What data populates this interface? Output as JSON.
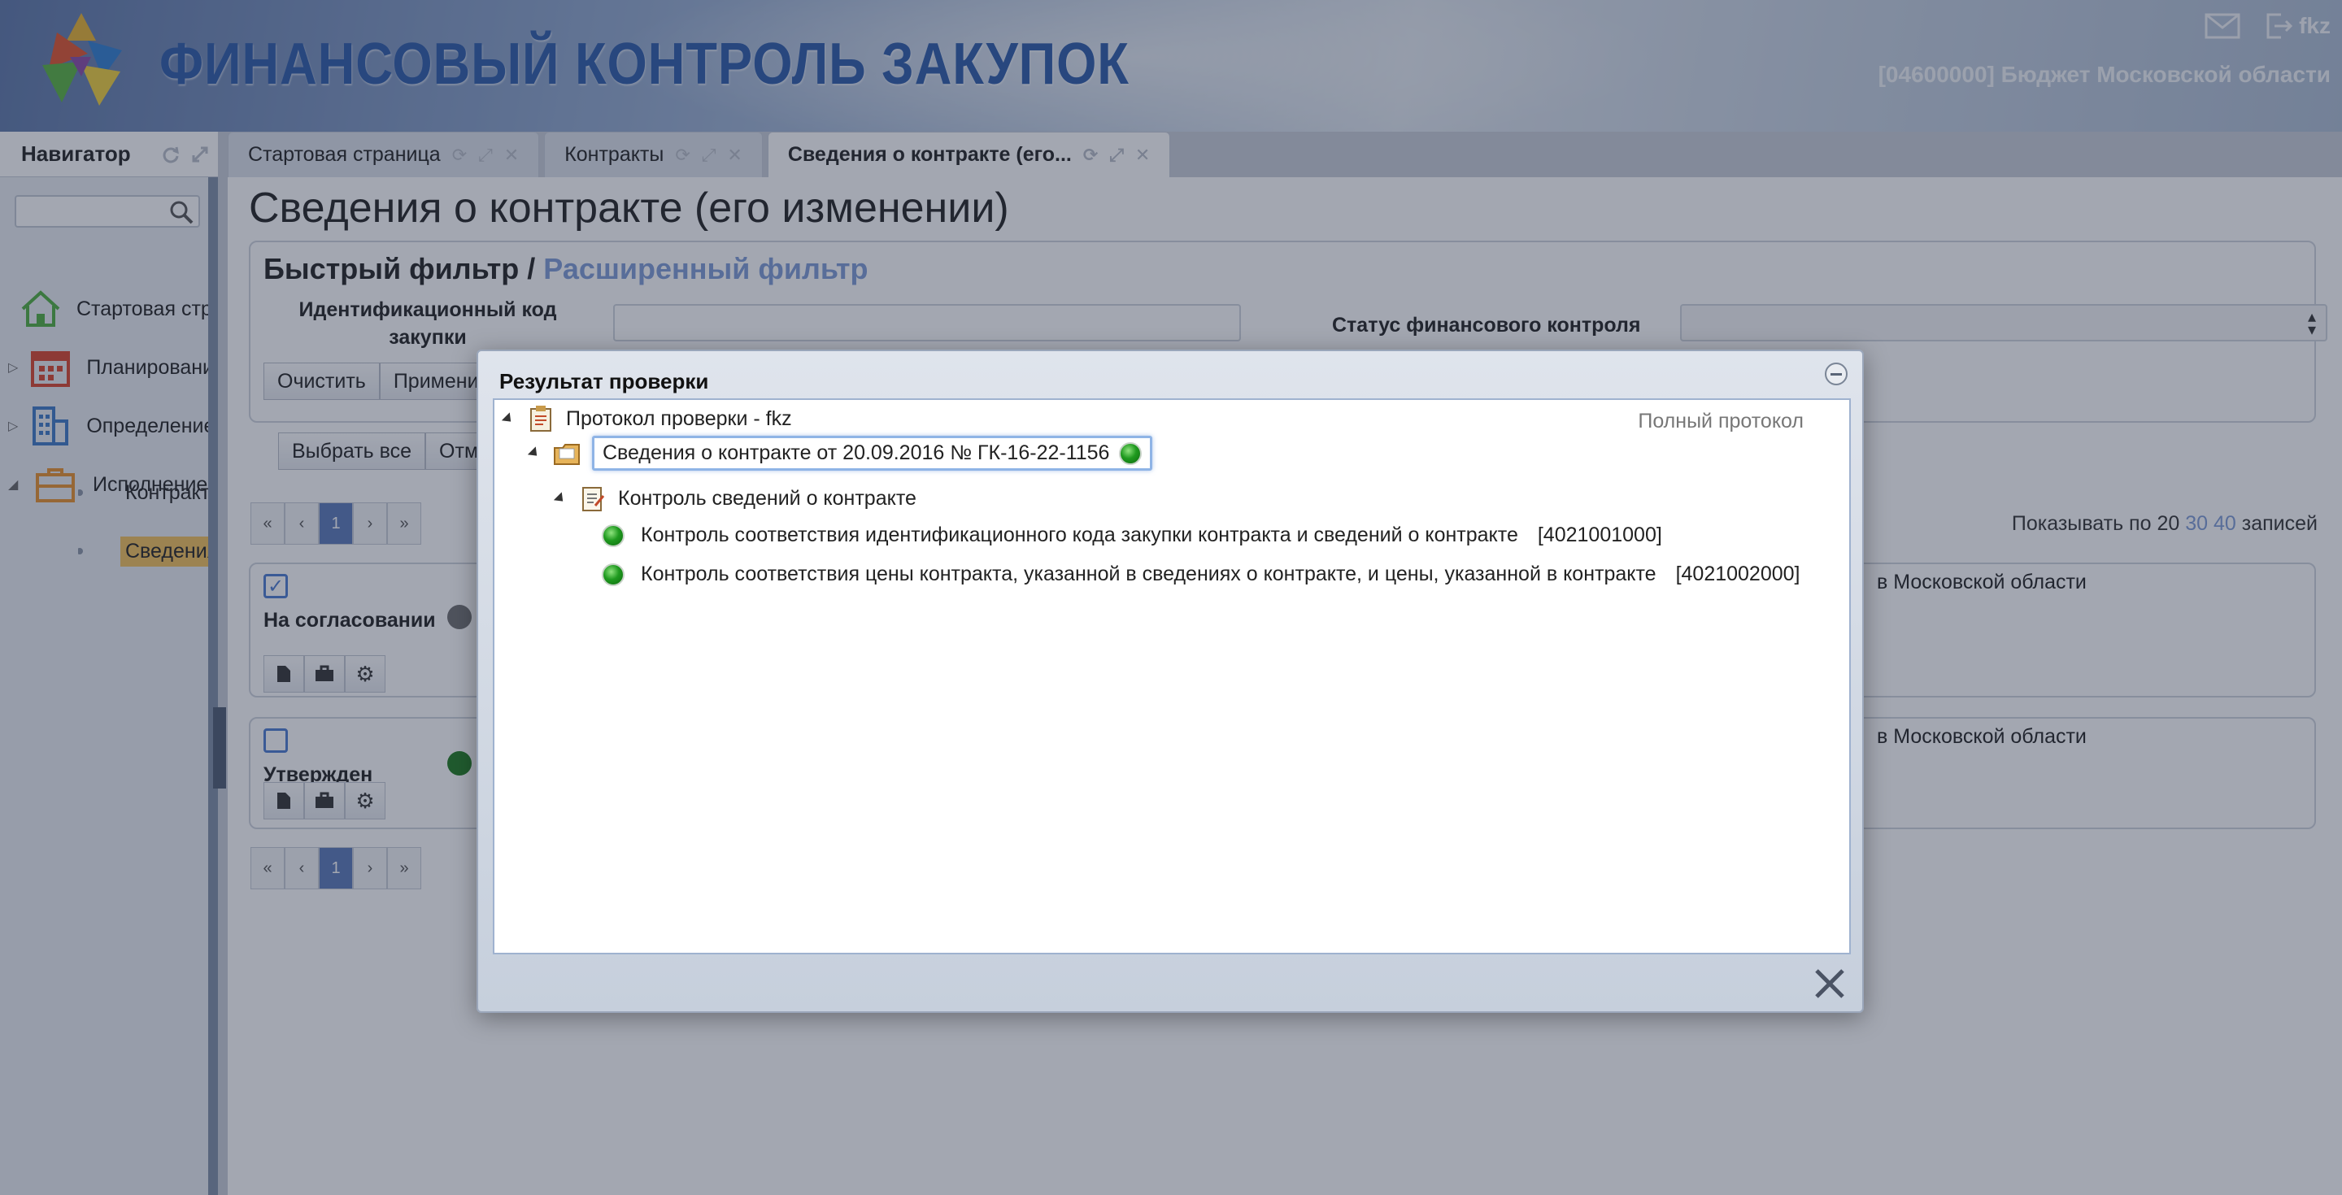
{
  "header": {
    "app_title": "ФИНАНСОВЫЙ КОНТРОЛЬ ЗАКУПОК",
    "budget": "[04600000] Бюджет Московской области",
    "user": "fkz",
    "icons": [
      "mail-icon",
      "logout-icon"
    ]
  },
  "navigator": {
    "title": "Навигатор",
    "search_placeholder": "",
    "items": [
      {
        "label": "Стартовая страница",
        "icon": "home-icon"
      },
      {
        "label": "Планирование",
        "icon": "calendar-icon"
      },
      {
        "label": "Определение",
        "icon": "building-icon"
      },
      {
        "label": "Исполнение",
        "icon": "briefcase-icon"
      }
    ],
    "subitems": [
      {
        "label": "Контракты",
        "active": false
      },
      {
        "label": "Сведения о контракте",
        "active": true
      }
    ]
  },
  "tabs": [
    {
      "label": "Стартовая страница",
      "active": false
    },
    {
      "label": "Контракты",
      "active": false
    },
    {
      "label": "Сведения о контракте (его...",
      "active": true
    }
  ],
  "main": {
    "page_title": "Сведения о контракте (его изменении)",
    "filter": {
      "quick": "Быстрый фильтр",
      "separator": "/",
      "advanced": "Расширенный фильтр",
      "field1_label": "Идентификационный код закупки",
      "field1_value": "",
      "field2_label": "Статус финансового контроля",
      "field2_value": "",
      "clear_label": "Очистить",
      "apply_label": "Применить"
    },
    "select_all_label": "Выбрать все",
    "cancel_label": "Отмена",
    "pager": {
      "first": "«",
      "prev": "‹",
      "page": "1",
      "next": "›",
      "last": "»"
    },
    "show_per": {
      "prefix": "Показывать по",
      "opt1": "20",
      "opt2": "30",
      "opt3": "40",
      "suffix": "записей"
    },
    "records": [
      {
        "status": "На согласовании",
        "checked": true,
        "dot_color": "#6e6e6e",
        "text": "в Московской области"
      },
      {
        "status": "Утвержден",
        "checked": false,
        "dot_color": "#1e7b1e",
        "text": "в Московской области"
      }
    ]
  },
  "modal": {
    "title": "Результат проверки",
    "full_protocol": "Полный протокол",
    "tree": {
      "root": "Протокол проверки - fkz",
      "node": "Сведения о контракте от 20.09.2016 № ГК-16-22-1156",
      "group": "Контроль сведений о контракте",
      "checks": [
        {
          "label": "Контроль соответствия идентификационного кода закупки контракта и сведений о контракте",
          "code": "[4021001000]"
        },
        {
          "label": "Контроль соответствия цены контракта, указанной в сведениях о контракте, и цены, указанной в контракте",
          "code": "[4021002000]"
        }
      ]
    }
  }
}
